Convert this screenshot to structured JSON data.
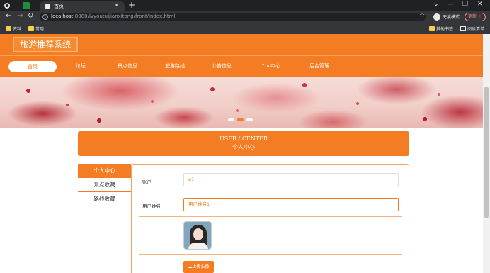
{
  "browser": {
    "tab_title": "首页",
    "url_host": "localhost",
    "url_rest": ":8080/lvyoutuijianxitong/front/index.html",
    "incognito_label": "无痕模式",
    "update_label": "更新",
    "bookmarks": [
      "资料",
      "常用"
    ],
    "other_bookmarks": "其他书签",
    "reading_list": "阅读清单"
  },
  "site": {
    "logo": "旅游推荐系统",
    "nav": [
      "首页",
      "论坛",
      "景点信息",
      "旅游路线",
      "公告信息",
      "个人中心",
      "后台管理"
    ],
    "accent": "#f47c22"
  },
  "center": {
    "title_en": "USER / CENTER",
    "title_zh": "个人中心"
  },
  "sidebar": {
    "items": [
      "个人中心",
      "景点收藏",
      "路线收藏"
    ]
  },
  "form": {
    "account_label": "账户",
    "account_value": "a1",
    "username_label": "用户姓名",
    "username_value": "用户姓名1",
    "upload_label": "上传头像"
  },
  "icons": {
    "avatar": "woman-portrait",
    "upload": "cloud-upload-icon"
  }
}
